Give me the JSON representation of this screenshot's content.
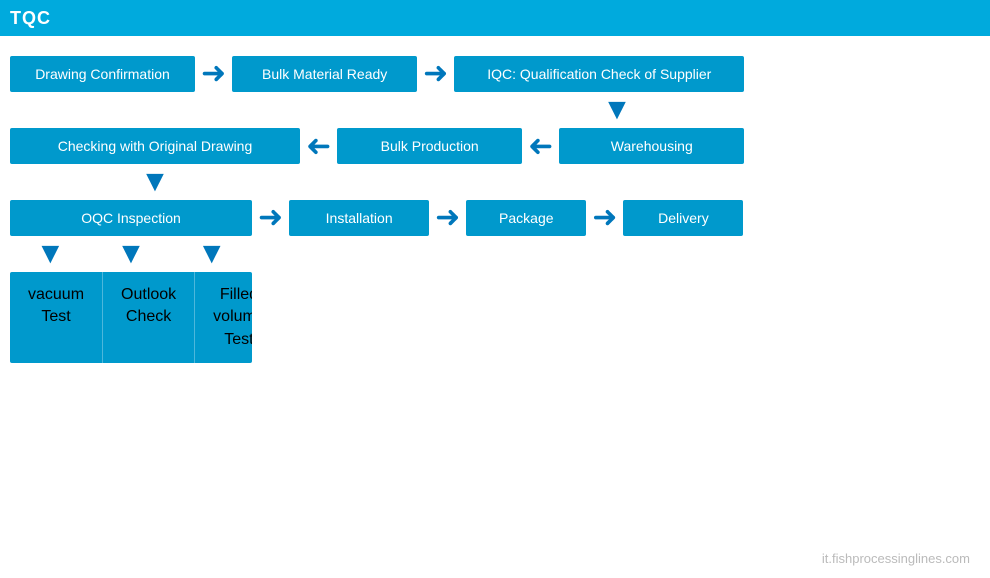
{
  "header": {
    "title": "TQC"
  },
  "flow": {
    "row1": {
      "box1": "Drawing Confirmation",
      "box2": "Bulk Material Ready",
      "box3": "IQC: Qualification Check of Supplier"
    },
    "row2": {
      "box1": "Checking with Original Drawing",
      "box2": "Bulk Production",
      "box3": "Warehousing"
    },
    "row3": {
      "box1": "OQC  Inspection",
      "box2": "Installation",
      "box3": "Package",
      "box4": "Delivery"
    },
    "row4": {
      "item1_line1": "vacuum",
      "item1_line2": "Test",
      "item2_line1": "Outlook",
      "item2_line2": "Check",
      "item3_line1": "Filled volume",
      "item3_line2": "Test"
    }
  },
  "watermark": "it.fishprocessinglines.com"
}
